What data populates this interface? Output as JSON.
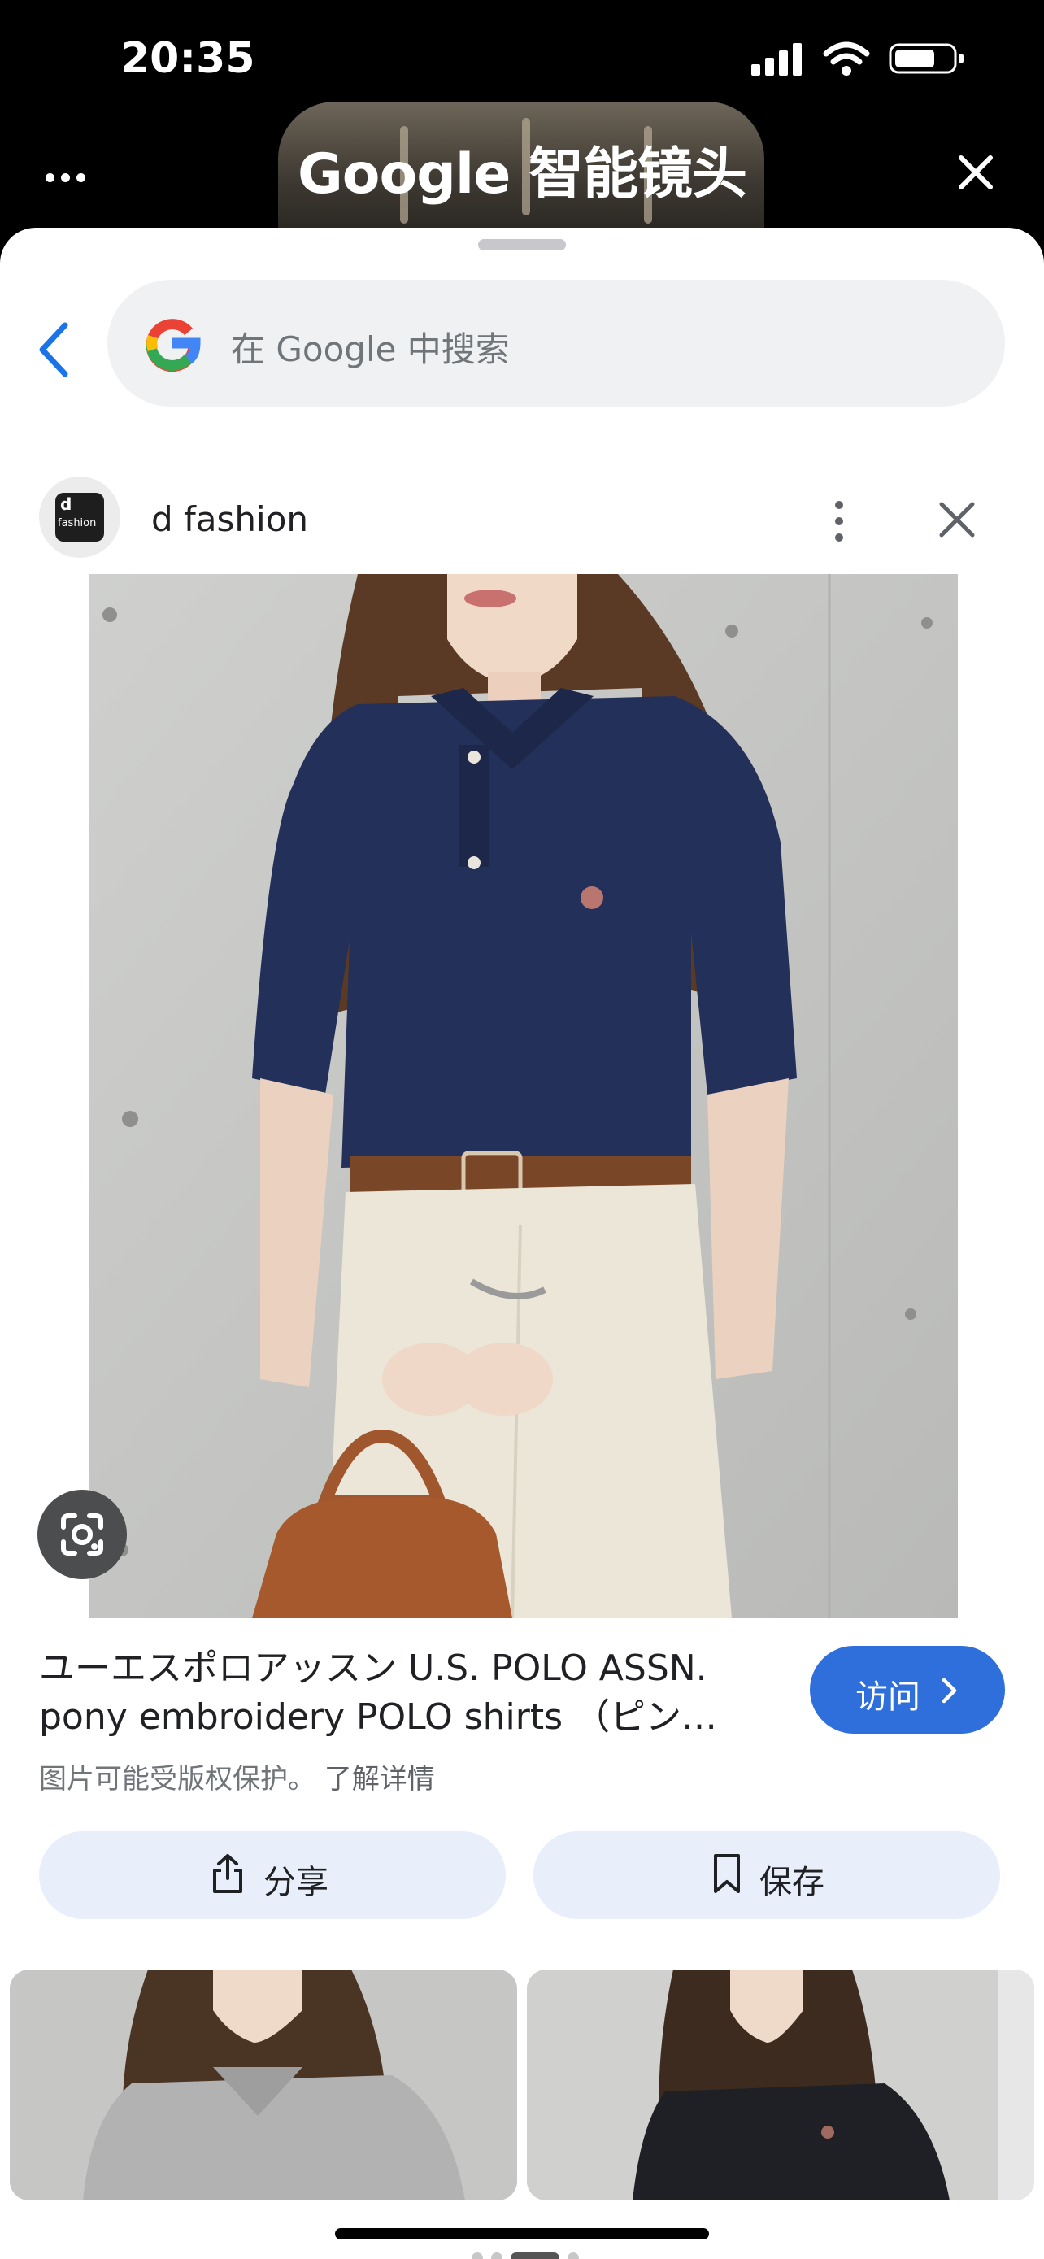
{
  "status_bar": {
    "time": "20:35"
  },
  "lens_header": {
    "title": "Google 智能镜头"
  },
  "search": {
    "placeholder": "在 Google 中搜索"
  },
  "source": {
    "name": "d fashion",
    "logo_text_top": "d",
    "logo_text_bottom": "fashion"
  },
  "result": {
    "title_line1": "ユーエスポロアッスン U.S. POLO ASSN.",
    "title_line2": "pony embroidery POLO shirts （ピン…",
    "visit_label": "访问",
    "copyright_text": "图片可能受版权保护。",
    "learn_more": "了解详情"
  },
  "actions": {
    "share_label": "分享",
    "save_label": "保存"
  },
  "colors": {
    "accent": "#2f6fdb",
    "action_bg": "#e8eefa",
    "shirt_navy": "#23305a"
  }
}
